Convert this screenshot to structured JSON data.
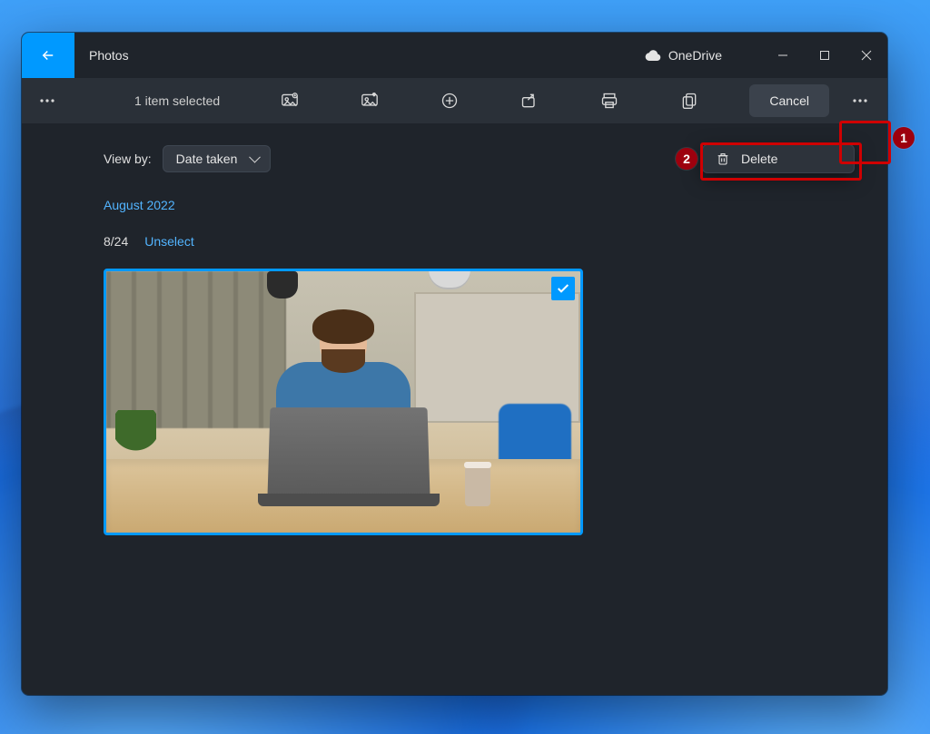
{
  "titlebar": {
    "app_title": "Photos",
    "onedrive_label": "OneDrive"
  },
  "toolbar": {
    "selection_text": "1 item selected",
    "cancel_label": "Cancel"
  },
  "viewby": {
    "label": "View by:",
    "value": "Date taken"
  },
  "group": {
    "month": "August 2022",
    "date": "8/24",
    "unselect_label": "Unselect"
  },
  "menu": {
    "delete_label": "Delete"
  },
  "annotations": {
    "badge1": "1",
    "badge2": "2"
  }
}
